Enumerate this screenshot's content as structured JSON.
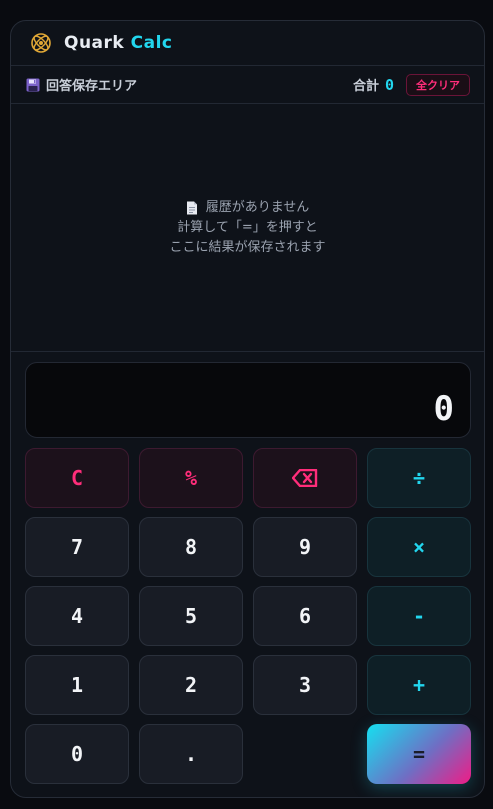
{
  "app": {
    "title_part1": "Quark",
    "title_part2": "Calc"
  },
  "save_area": {
    "label": "回答保存エリア",
    "total_label": "合計",
    "total_value": "0",
    "clear_all_label": "全クリア"
  },
  "history": {
    "empty_title": "履歴がありません",
    "hint_line1": "計算して「=」を押すと",
    "hint_line2": "ここに結果が保存されます"
  },
  "display": {
    "value": "0"
  },
  "keys": {
    "clear": "C",
    "percent": "%",
    "divide": "÷",
    "seven": "7",
    "eight": "8",
    "nine": "9",
    "multiply": "×",
    "four": "4",
    "five": "5",
    "six": "6",
    "minus": "-",
    "one": "1",
    "two": "2",
    "three": "3",
    "plus": "+",
    "zero": "0",
    "dot": ".",
    "equals": "="
  },
  "icons": {
    "logo": "atom-logo-icon",
    "save": "floppy-disk-icon",
    "empty_history": "document-icon",
    "backspace": "backspace-icon"
  },
  "colors": {
    "accent_cyan": "#22d6ee",
    "accent_pink": "#ff2d7a",
    "background": "#0e1219"
  }
}
